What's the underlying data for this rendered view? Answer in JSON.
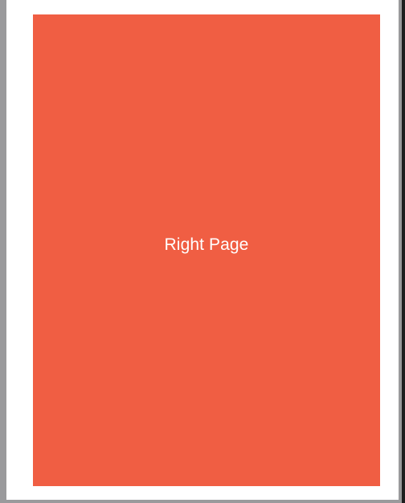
{
  "page": {
    "label": "Right Page",
    "panel_color": "#F05E43",
    "frame_color": "#9A9A9C",
    "background_color": "#FFFFFF"
  }
}
